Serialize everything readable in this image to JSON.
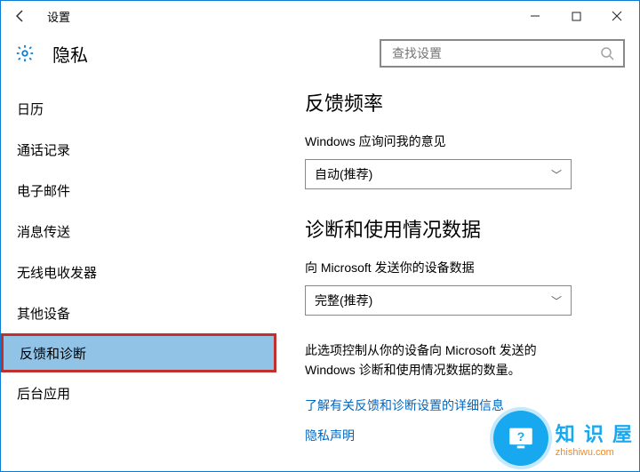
{
  "titlebar": {
    "title": "设置"
  },
  "header": {
    "page_title": "隐私",
    "search_placeholder": "查找设置"
  },
  "sidebar": {
    "items": [
      {
        "label": "日历"
      },
      {
        "label": "通话记录"
      },
      {
        "label": "电子邮件"
      },
      {
        "label": "消息传送"
      },
      {
        "label": "无线电收发器"
      },
      {
        "label": "其他设备"
      },
      {
        "label": "反馈和诊断"
      },
      {
        "label": "后台应用"
      }
    ]
  },
  "main": {
    "section1_title": "反馈频率",
    "s1_label": "Windows 应询问我的意见",
    "s1_value": "自动(推荐)",
    "section2_title": "诊断和使用情况数据",
    "s2_label": "向 Microsoft 发送你的设备数据",
    "s2_value": "完整(推荐)",
    "note": "此选项控制从你的设备向 Microsoft 发送的 Windows 诊断和使用情况数据的数量。",
    "link1": "了解有关反馈和诊断设置的详细信息",
    "link2": "隐私声明"
  },
  "watermark": {
    "cn": "知 识 屋",
    "en": "zhishiwu.com"
  }
}
